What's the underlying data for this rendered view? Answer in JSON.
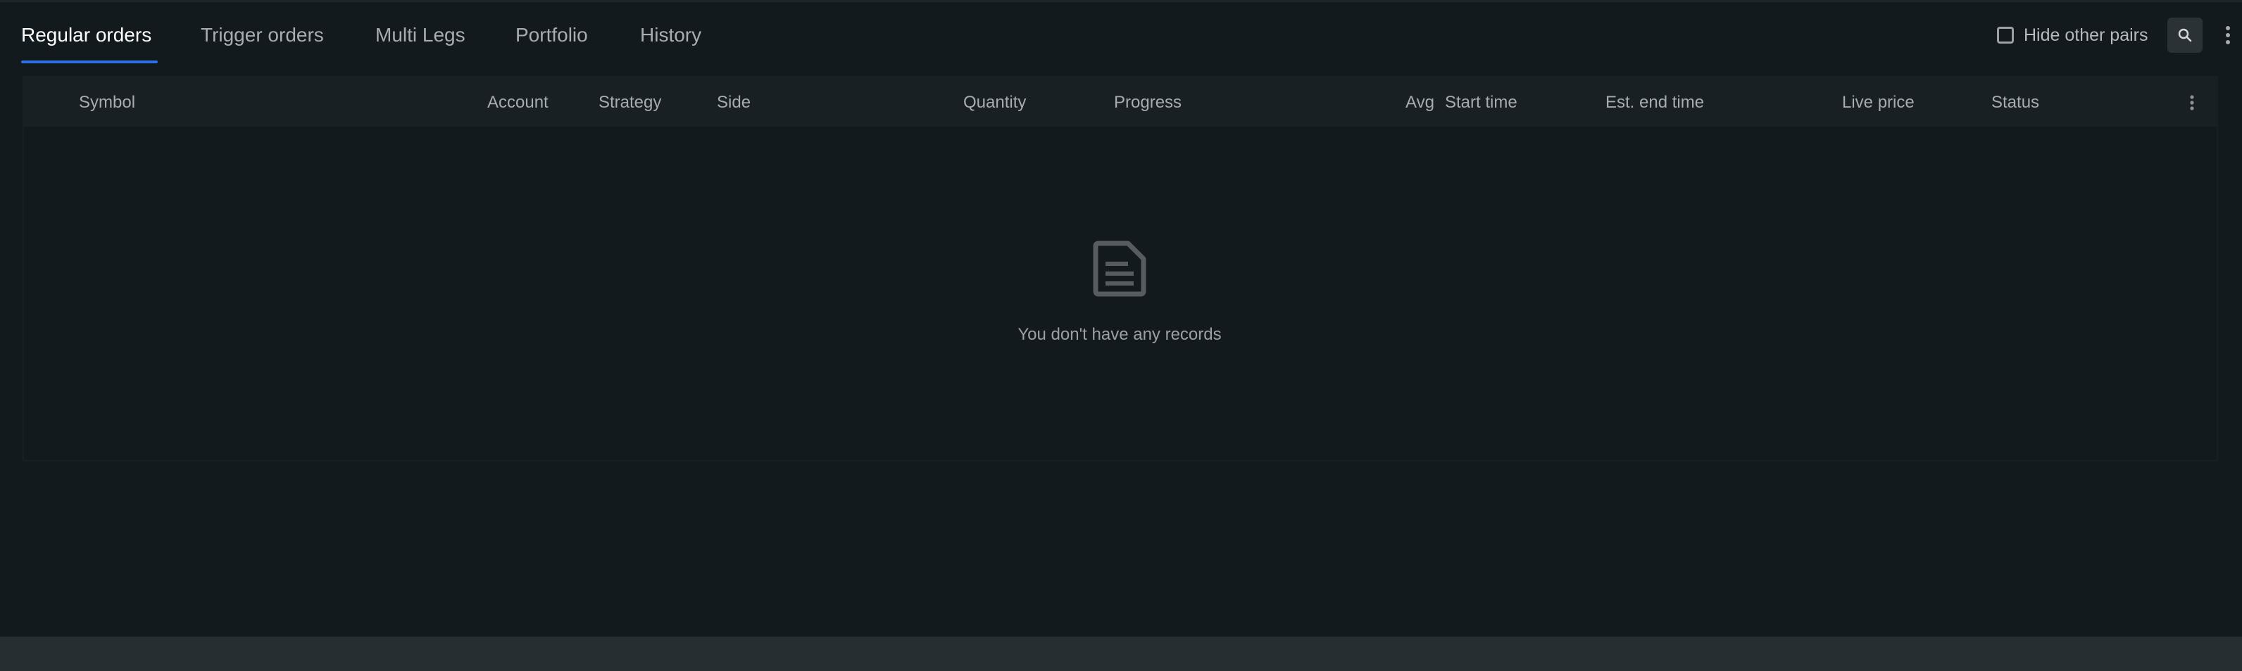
{
  "tabs": [
    {
      "label": "Regular orders",
      "active": true
    },
    {
      "label": "Trigger orders",
      "active": false
    },
    {
      "label": "Multi Legs",
      "active": false
    },
    {
      "label": "Portfolio",
      "active": false
    },
    {
      "label": "History",
      "active": false
    }
  ],
  "toolbar": {
    "hide_other_pairs_label": "Hide other pairs",
    "hide_other_pairs_checked": false,
    "search_icon": "search-icon",
    "more_icon": "more-vertical-icon"
  },
  "table": {
    "columns": [
      "Symbol",
      "Account",
      "Strategy",
      "Side",
      "Quantity",
      "Progress",
      "Avg",
      "Start time",
      "Est. end time",
      "Live price",
      "Status"
    ],
    "rows": []
  },
  "empty_state": {
    "icon": "document-icon",
    "message": "You don't have any records"
  },
  "colors": {
    "background": "#131a1d",
    "header_background": "#182023",
    "accent": "#2f6fe0",
    "footer": "#252e31"
  }
}
